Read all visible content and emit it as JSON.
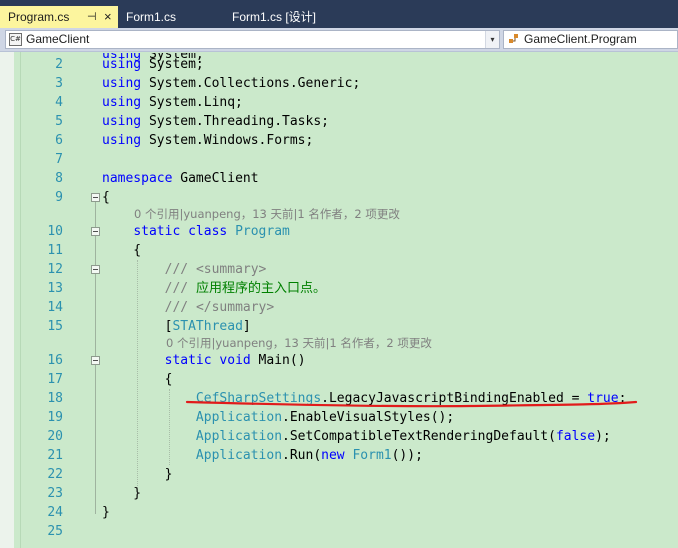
{
  "tabs": [
    {
      "label": "Program.cs",
      "active": true
    },
    {
      "label": "Form1.cs",
      "active": false
    },
    {
      "label": "Form1.cs [设计]",
      "active": false
    }
  ],
  "tab_controls": {
    "pin": "⊣",
    "close": "×"
  },
  "navbar": {
    "project_icon": "C#",
    "project": "GameClient",
    "dropdown_arrow": "▾",
    "type_icon": "class-icon",
    "type": "GameClient.Program"
  },
  "colors": {
    "editor_bg": "#cbe9cb",
    "keyword": "#0000ff",
    "type": "#2b91af",
    "comment": "#008000",
    "annotation_underline": "#e11b1b"
  },
  "lines": [
    {
      "n": "",
      "code": "using System;"
    },
    {
      "n": "2",
      "code": "using System;"
    },
    {
      "n": "3",
      "code": "using System.Collections.Generic;"
    },
    {
      "n": "4",
      "code": "using System.Linq;"
    },
    {
      "n": "5",
      "code": "using System.Threading.Tasks;"
    },
    {
      "n": "6",
      "code": "using System.Windows.Forms;"
    },
    {
      "n": "7",
      "code": ""
    },
    {
      "n": "8",
      "code": "namespace GameClient"
    },
    {
      "n": "9",
      "code": "{"
    },
    {
      "n": "10",
      "code": "static class Program"
    },
    {
      "n": "11",
      "code": "{"
    },
    {
      "n": "12",
      "code": "/// <summary>"
    },
    {
      "n": "13",
      "code": "/// 应用程序的主入口点。"
    },
    {
      "n": "14",
      "code": "/// </summary>"
    },
    {
      "n": "15",
      "code": "[STAThread]"
    },
    {
      "n": "16",
      "code": "static void Main()"
    },
    {
      "n": "17",
      "code": "{"
    },
    {
      "n": "18",
      "code": "CefSharpSettings.LegacyJavascriptBindingEnabled = true;"
    },
    {
      "n": "19",
      "code": "Application.EnableVisualStyles();"
    },
    {
      "n": "20",
      "code": "Application.SetCompatibleTextRenderingDefault(false);"
    },
    {
      "n": "21",
      "code": "Application.Run(new Form1());"
    },
    {
      "n": "22",
      "code": "}"
    },
    {
      "n": "23",
      "code": "}"
    },
    {
      "n": "24",
      "code": "}"
    },
    {
      "n": "25",
      "code": ""
    }
  ],
  "codelens": [
    "0 个引用|yuanpeng，13 天前|1 名作者，2 项更改",
    "0 个引用|yuanpeng，13 天前|1 名作者，2 项更改"
  ]
}
